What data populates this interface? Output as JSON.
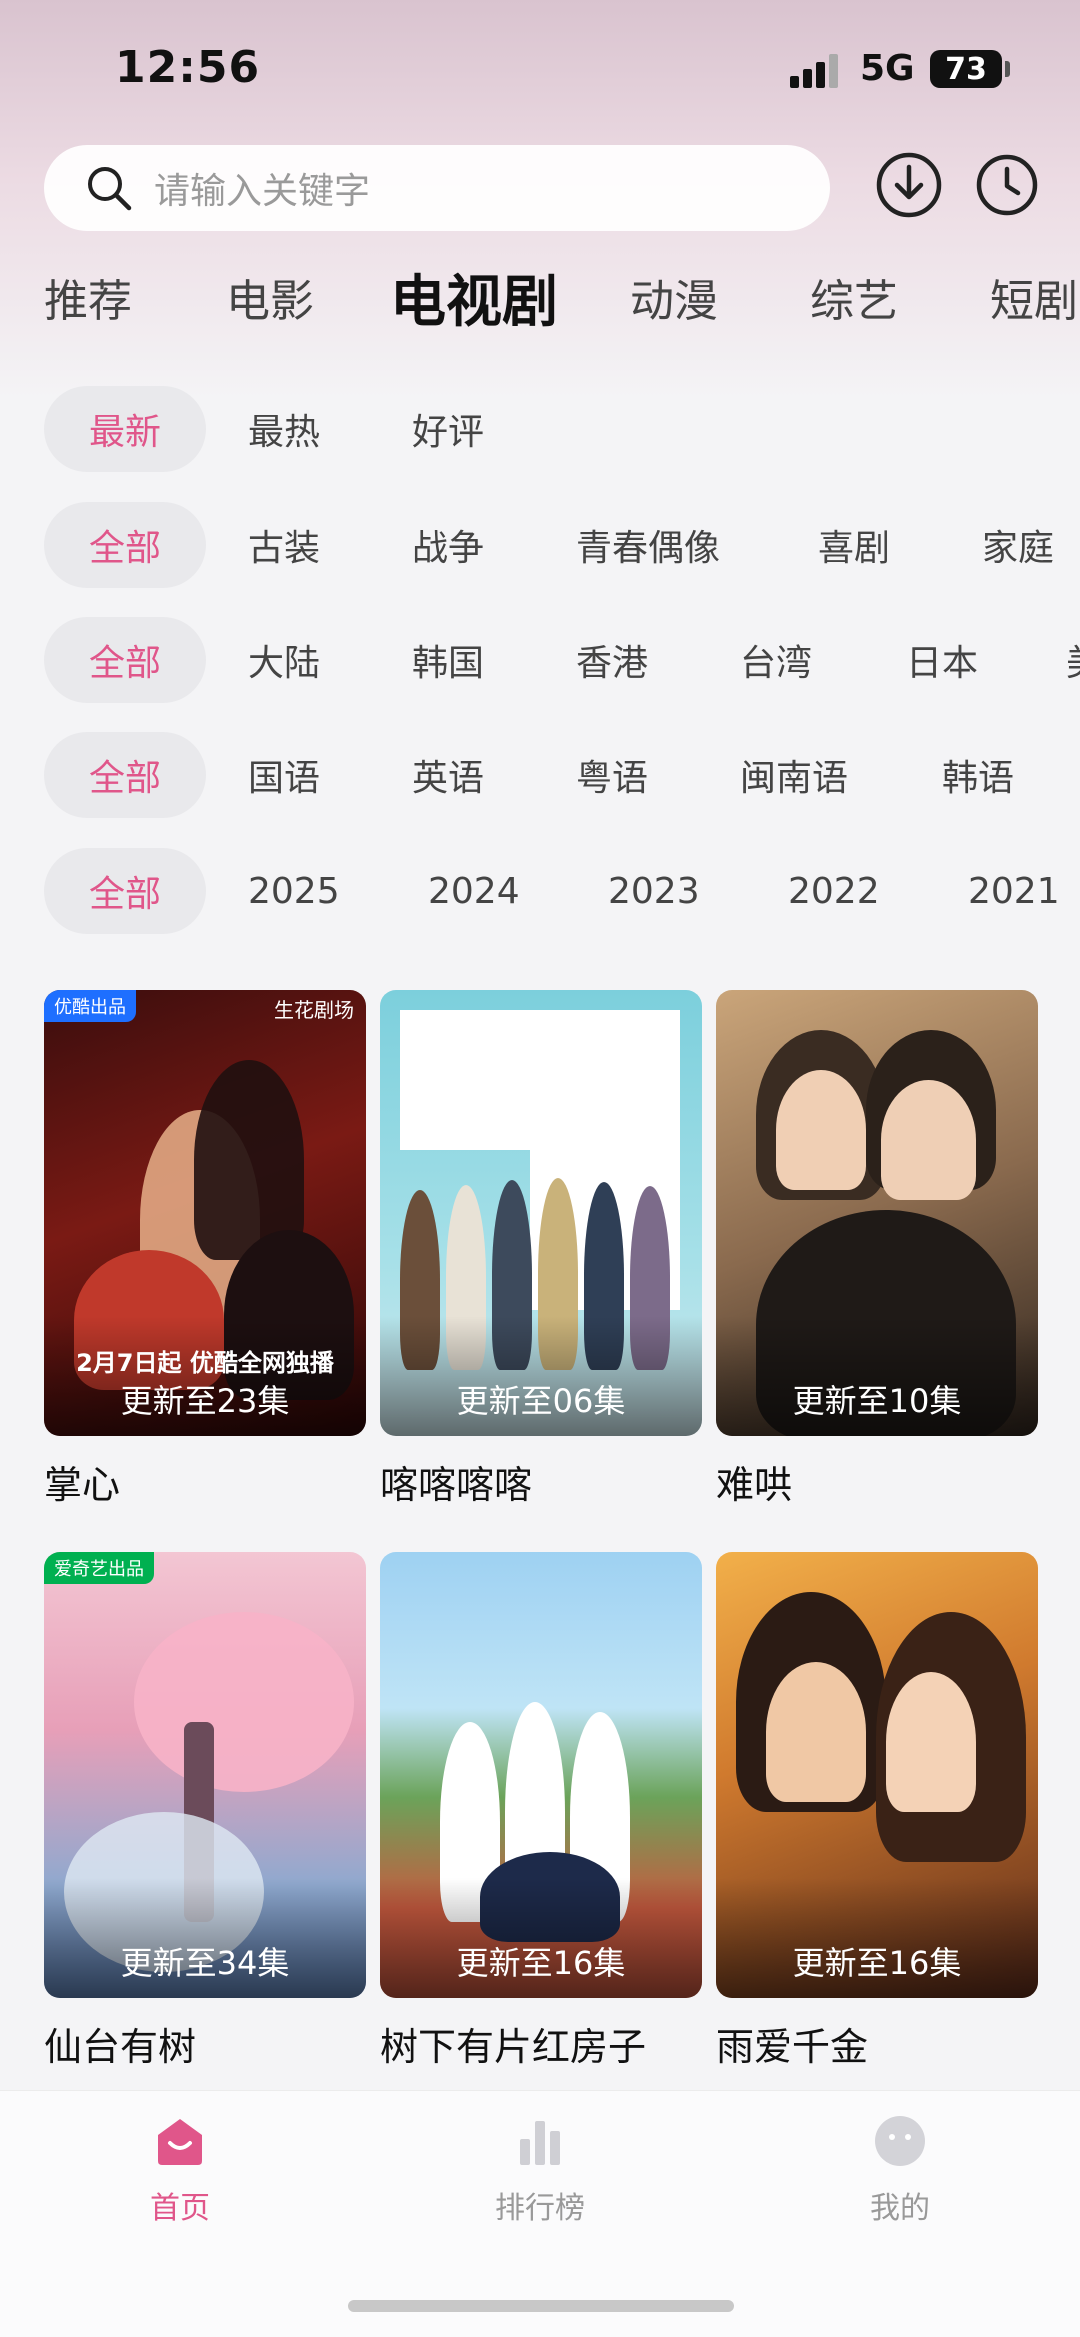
{
  "status": {
    "time": "12:56",
    "network": "5G",
    "battery": "73"
  },
  "search": {
    "placeholder": "请输入关键字"
  },
  "icons": {
    "search": "search-icon",
    "download": "download-icon",
    "history": "history-icon"
  },
  "main_tabs": [
    {
      "label": "推荐"
    },
    {
      "label": "电影"
    },
    {
      "label": "电视剧"
    },
    {
      "label": "动漫"
    },
    {
      "label": "综艺"
    },
    {
      "label": "短剧"
    }
  ],
  "active_main_tab": "电视剧",
  "filters": {
    "sort": [
      "最新",
      "最热",
      "好评"
    ],
    "genre": [
      "全部",
      "古装",
      "战争",
      "青春偶像",
      "喜剧",
      "家庭"
    ],
    "region": [
      "全部",
      "大陆",
      "韩国",
      "香港",
      "台湾",
      "日本",
      "美"
    ],
    "language": [
      "全部",
      "国语",
      "英语",
      "粤语",
      "闽南语",
      "韩语"
    ],
    "year": [
      "全部",
      "2025",
      "2024",
      "2023",
      "2022",
      "2021"
    ]
  },
  "shows": [
    {
      "title": "掌心",
      "update": "更新至23集",
      "badge": "优酷出品",
      "overlay_text": "2月7日起 优酷全网独播",
      "corner": "生花剧场"
    },
    {
      "title": "喀喀喀喀",
      "update": "更新至06集"
    },
    {
      "title": "难哄",
      "update": "更新至10集"
    },
    {
      "title": "仙台有树",
      "update": "更新至34集",
      "badge": "爱奇艺出品"
    },
    {
      "title": "树下有片红房子",
      "update": "更新至16集"
    },
    {
      "title": "雨爱千金",
      "update": "更新至16集"
    }
  ],
  "bottom_nav": [
    {
      "label": "首页",
      "icon": "home-icon",
      "active": true
    },
    {
      "label": "排行榜",
      "icon": "ranking-icon",
      "active": false
    },
    {
      "label": "我的",
      "icon": "profile-icon",
      "active": false
    }
  ],
  "colors": {
    "accent": "#e0568a",
    "background": "#f4f4f6"
  }
}
